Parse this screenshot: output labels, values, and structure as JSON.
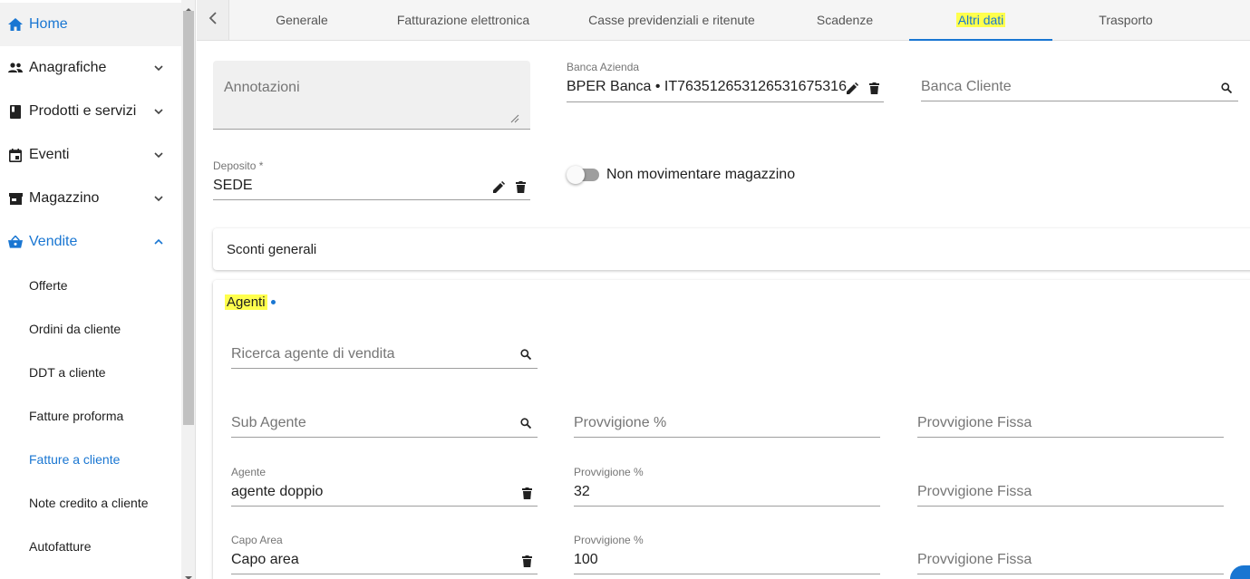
{
  "sidebar": {
    "items": [
      {
        "label": "Home",
        "icon": "home-icon"
      },
      {
        "label": "Anagrafiche",
        "icon": "people-icon"
      },
      {
        "label": "Prodotti e servizi",
        "icon": "book-icon"
      },
      {
        "label": "Eventi",
        "icon": "calendar-icon"
      },
      {
        "label": "Magazzino",
        "icon": "store-icon"
      },
      {
        "label": "Vendite",
        "icon": "basket-icon"
      }
    ],
    "sub_items": [
      "Offerte",
      "Ordini da cliente",
      "DDT a cliente",
      "Fatture proforma",
      "Fatture a cliente",
      "Note credito a cliente",
      "Autofatture"
    ]
  },
  "tabs": [
    "Generale",
    "Fatturazione elettronica",
    "Casse previdenziali e ritenute",
    "Scadenze",
    "Altri dati",
    "Trasporto"
  ],
  "form": {
    "annotazioni_placeholder": "Annotazioni",
    "banca_azienda": {
      "label": "Banca Azienda",
      "value": "BPER Banca • IT76351265312653167531​6"
    },
    "banca_cliente": {
      "placeholder": "Banca Cliente"
    },
    "deposito": {
      "label": "Deposito *",
      "value": "SEDE"
    },
    "non_movimentare_label": "Non movimentare magazzino"
  },
  "panels": {
    "sconti_title": "Sconti generali",
    "agenti_title": "Agenti"
  },
  "agenti": {
    "ricerca_placeholder": "Ricerca agente di vendita",
    "sub_agente_placeholder": "Sub Agente",
    "provvigione_pct_placeholder": "Provvigione %",
    "provvigione_fissa_placeholder": "Provvigione Fissa",
    "agente": {
      "label": "Agente",
      "value": "agente doppio"
    },
    "agente_provvigione": {
      "label": "Provvigione %",
      "value": "32"
    },
    "agente_fissa_placeholder": "Provvigione Fissa",
    "capo_area": {
      "label": "Capo Area",
      "value": "Capo area"
    },
    "capo_area_provvigione": {
      "label": "Provvigione %",
      "value": "100"
    },
    "capo_area_fissa_placeholder": "Provvigione Fissa"
  },
  "colors": {
    "accent": "#1976d2",
    "highlight": "#ffff4d"
  }
}
